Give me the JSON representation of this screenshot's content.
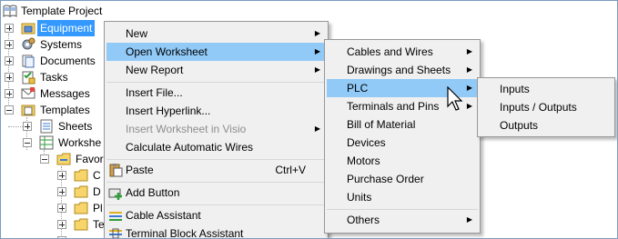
{
  "tree": {
    "root": "Template Project",
    "items": [
      {
        "label": "Equipment",
        "icon": "folder-equipment-icon",
        "selected": true
      },
      {
        "label": "Systems",
        "icon": "gear-icon"
      },
      {
        "label": "Documents",
        "icon": "documents-icon"
      },
      {
        "label": "Tasks",
        "icon": "tasks-icon"
      },
      {
        "label": "Messages",
        "icon": "messages-icon"
      },
      {
        "label": "Templates",
        "icon": "templates-icon"
      },
      {
        "label": "Sheets",
        "icon": "sheets-icon"
      },
      {
        "label": "Workshe",
        "icon": "worksheets-icon"
      },
      {
        "label": "Favor",
        "icon": "folder-icon"
      },
      {
        "label": "C",
        "icon": "folder-icon"
      },
      {
        "label": "D",
        "icon": "folder-icon"
      },
      {
        "label": "Pl",
        "icon": "folder-icon"
      },
      {
        "label": "Te",
        "icon": "folder-icon"
      }
    ]
  },
  "context_menu": {
    "items": [
      {
        "label": "New",
        "submenu": true
      },
      {
        "label": "Open Worksheet",
        "submenu": true,
        "highlighted": true
      },
      {
        "label": "New Report",
        "submenu": true
      },
      {
        "label": "Insert File..."
      },
      {
        "label": "Insert Hyperlink..."
      },
      {
        "label": "Insert Worksheet in Visio",
        "submenu": true,
        "disabled": true
      },
      {
        "label": "Calculate Automatic Wires"
      },
      {
        "label": "Paste",
        "shortcut": "Ctrl+V",
        "icon": "paste-icon"
      },
      {
        "label": "Add Button",
        "icon": "add-button-icon"
      },
      {
        "label": "Cable Assistant",
        "icon": "cable-assistant-icon"
      },
      {
        "label": "Terminal Block Assistant",
        "icon": "terminal-block-icon"
      }
    ]
  },
  "worksheet_menu": {
    "items": [
      {
        "label": "Cables and Wires",
        "submenu": true
      },
      {
        "label": "Drawings and Sheets",
        "submenu": true
      },
      {
        "label": "PLC",
        "submenu": true,
        "highlighted": true
      },
      {
        "label": "Terminals and Pins",
        "submenu": true
      },
      {
        "label": "Bill of Material"
      },
      {
        "label": "Devices"
      },
      {
        "label": "Motors"
      },
      {
        "label": "Purchase Order"
      },
      {
        "label": "Units"
      },
      {
        "label": "Others",
        "submenu": true
      }
    ]
  },
  "plc_menu": {
    "items": [
      {
        "label": "Inputs"
      },
      {
        "label": "Inputs / Outputs"
      },
      {
        "label": "Outputs"
      }
    ]
  },
  "colors": {
    "selection": "#3399ff",
    "menu_highlight": "#91c9f7",
    "menu_bg": "#f0f0f0"
  }
}
